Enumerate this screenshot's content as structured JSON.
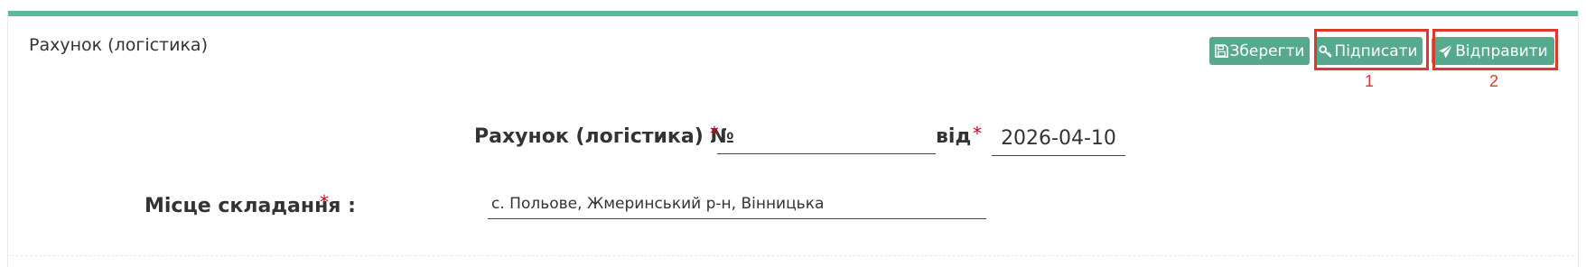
{
  "panel": {
    "title": "Рахунок (логістика)",
    "accent_color": "#5bb9a0"
  },
  "toolbar": {
    "save_label": "Зберегти",
    "sign_label": "Підписати",
    "send_label": "Відправити",
    "button_color": "#56a98d",
    "save_icon": "floppy-disk-icon",
    "sign_icon": "key-icon",
    "send_icon": "paper-plane-icon"
  },
  "annotations": {
    "color": "#e0372a",
    "marker_1": "1",
    "marker_2": "2"
  },
  "form": {
    "doc_number_label": "Рахунок (логістика) №",
    "doc_number_value": "",
    "date_label": "від",
    "date_value": "2026-04-10",
    "place_label": "Місце складання :",
    "place_value": "с. Польове, Жмеринський р-н, Вінницька",
    "required_marker": "*",
    "required_color": "#d0021b"
  }
}
